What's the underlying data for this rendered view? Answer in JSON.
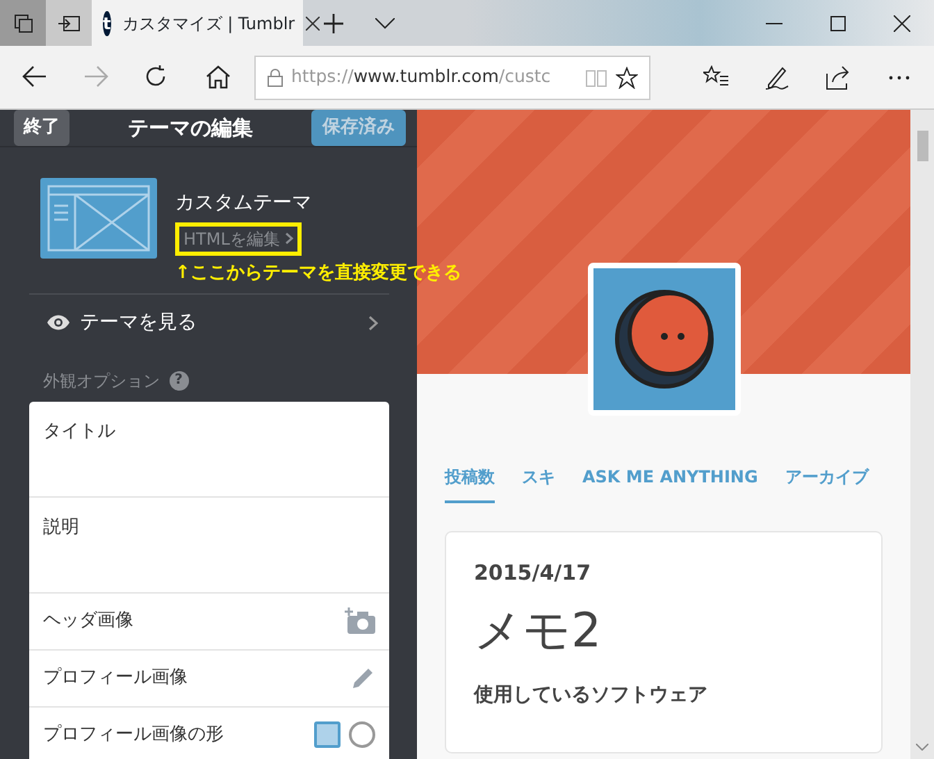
{
  "browser": {
    "tab_title": "カスタマイズ | Tumblr",
    "tab_logo": "t",
    "url_scheme": "https://",
    "url_host": "www.tumblr.com",
    "url_path": "/custc"
  },
  "editor": {
    "done_button": "終了",
    "title": "テーマの編集",
    "save_button": "保存済み",
    "save_disabled": true,
    "theme_name": "カスタムテーマ",
    "edit_html_link": "HTMLを編集",
    "annotation": "↑ここからテーマを直接変更できる",
    "view_theme": "テーマを見る",
    "options_heading": "外観オプション",
    "help": "?",
    "options": [
      {
        "kind": "text",
        "label": "タイトル"
      },
      {
        "kind": "text",
        "label": "説明"
      },
      {
        "kind": "camera",
        "label": "ヘッダ画像"
      },
      {
        "kind": "pencil",
        "label": "プロフィール画像"
      },
      {
        "kind": "shape",
        "label": "プロフィール画像の形",
        "shapes": [
          {
            "kind": "square",
            "selected": true
          },
          {
            "kind": "circle",
            "selected": false
          }
        ]
      }
    ]
  },
  "preview": {
    "nav": [
      {
        "label": "投稿数",
        "selected": true
      },
      {
        "label": "スキ",
        "selected": false
      },
      {
        "label": "ASK ME ANYTHING",
        "selected": false
      },
      {
        "label": "アーカイブ",
        "selected": false
      }
    ],
    "post": {
      "date": "2015/4/17",
      "title": "メモ2",
      "subtitle": "使用しているソフトウェア"
    }
  }
}
